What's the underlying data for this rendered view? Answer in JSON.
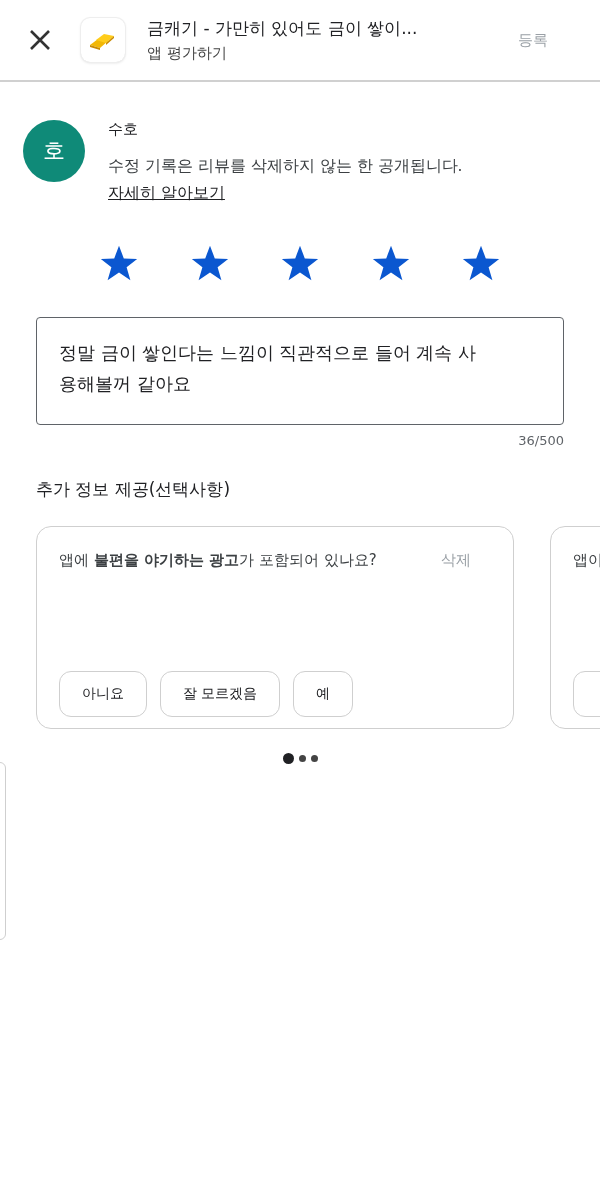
{
  "header": {
    "app_title": "금캐기 - 가만히 있어도 금이 쌓이...",
    "subtitle": "앱 평가하기",
    "submit": "등록",
    "submit_disabled": true
  },
  "user": {
    "avatar_letter": "호",
    "name": "수호",
    "notice": "수정 기록은 리뷰를 삭제하지 않는 한 공개됩니다.",
    "link": "자세히 알아보기"
  },
  "rating": {
    "stars": 5
  },
  "review": {
    "value": "정말 금이 쌓인다는 느낌이 직관적으로 들어 계속 사용해볼꺼 같아요",
    "counter": "36/500"
  },
  "extra": {
    "heading": "추가 정보 제공(선택사항)",
    "cards": [
      {
        "question": "앱에 **불편을 야기하는 광고**가 포함되어 있나요?",
        "delete": "삭제",
        "answers": [
          {
            "label": "아니요",
            "selected": false
          },
          {
            "label": "잘 모르겠음",
            "selected": false
          },
          {
            "label": "예",
            "selected": false
          }
        ]
      },
      {
        "question": "앱이",
        "answers": [
          {
            "selected": false
          }
        ]
      }
    ],
    "pages": [
      {
        "selected": true
      },
      {
        "selected": false
      },
      {
        "selected": false
      }
    ]
  }
}
